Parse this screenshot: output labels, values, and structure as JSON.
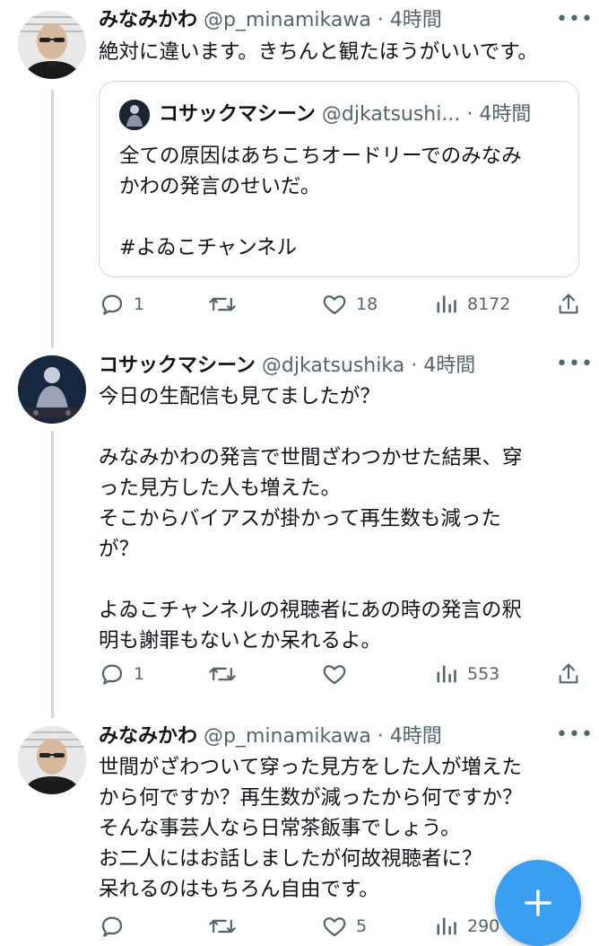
{
  "tweets": [
    {
      "author_name": "みなみかわ",
      "handle": "@p_minamikawa",
      "separator": "·",
      "time": "4時間",
      "avatar_icon": "avatar-man-glasses",
      "text": "絶対に違います。きちんと観たほうがいいです。",
      "quote": {
        "author_name": "コサックマシーン",
        "handle": "@djkatsushi...",
        "separator": "·",
        "time": "4時間",
        "text": "全ての原因はあちこちオードリーでのみなみ\nかわの発言のせいだ。\n\n#よゐこチャンネル"
      },
      "actions": {
        "reply": "1",
        "retweet": "",
        "like": "18",
        "views": "8172"
      }
    },
    {
      "author_name": "コサックマシーン",
      "handle": "@djkatsushika",
      "separator": "·",
      "time": "4時間",
      "avatar_icon": "avatar-dj-stage",
      "text": "今日の生配信も見てましたが？\n\nみなみかわの発言で世間ざわつかせた結果、穿\nった見方した人も増えた。\nそこからバイアスが掛かって再生数も減った\nが？\n\nよゐこチャンネルの視聴者にあの時の発言の釈\n明も謝罪もないとか呆れるよ。",
      "actions": {
        "reply": "1",
        "retweet": "",
        "like": "",
        "views": "553"
      }
    },
    {
      "author_name": "みなみかわ",
      "handle": "@p_minamikawa",
      "separator": "·",
      "time": "4時間",
      "avatar_icon": "avatar-man-glasses",
      "text": "世間がざわついて穿った見方をした人が増えた\nから何ですか？再生数が減ったから何ですか？\nそんな事芸人なら日常茶飯事でしょう。\nお二人にはお話しましたが何故視聴者に？\n呆れるのはもちろん自由です。",
      "actions": {
        "reply": "",
        "retweet": "",
        "like": "5",
        "views": "290"
      }
    }
  ],
  "more_label": "•••",
  "fab_icon": "compose-plus-icon",
  "colors": {
    "accent": "#3a9ff0",
    "muted": "#536471",
    "border": "#cfd9de"
  }
}
